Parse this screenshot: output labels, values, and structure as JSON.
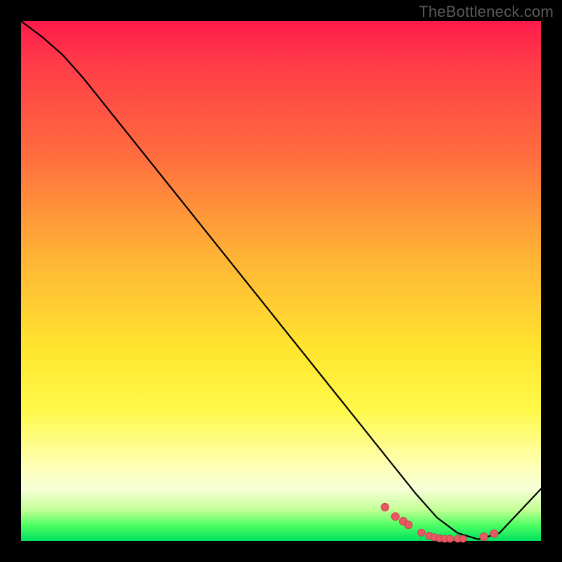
{
  "watermark": "TheBottleneck.com",
  "colors": {
    "background": "#000000",
    "curve": "#000000",
    "dot_fill": "#e85a63",
    "dot_stroke": "#ce3f4a",
    "gradient_top": "#ff1a4b",
    "gradient_bottom": "#00e060"
  },
  "chart_data": {
    "type": "line",
    "title": "",
    "xlabel": "",
    "ylabel": "",
    "xlim": [
      0,
      100
    ],
    "ylim": [
      0,
      100
    ],
    "series": [
      {
        "name": "curve",
        "x": [
          0,
          4,
          8,
          12,
          20,
          30,
          40,
          50,
          60,
          68,
          72,
          76,
          80,
          84,
          88,
          92,
          100
        ],
        "y": [
          100,
          97,
          93.5,
          89,
          79,
          66.5,
          54,
          41.5,
          29,
          19,
          14,
          9,
          4.5,
          1.5,
          0.3,
          1.5,
          10
        ]
      }
    ],
    "markers": {
      "name": "dots",
      "x": [
        70,
        72,
        73.5,
        74.5,
        77,
        78.5,
        79.5,
        80.5,
        81.5,
        82.5,
        84,
        85,
        89,
        91
      ],
      "y": [
        6.5,
        4.7,
        3.8,
        3.1,
        1.6,
        1.0,
        0.7,
        0.5,
        0.4,
        0.4,
        0.4,
        0.4,
        0.8,
        1.4
      ],
      "r": [
        5.5,
        5.5,
        5.5,
        5.5,
        5.0,
        5.0,
        5.0,
        5.0,
        5.0,
        5.0,
        5.0,
        5.0,
        5.5,
        5.5
      ]
    }
  }
}
